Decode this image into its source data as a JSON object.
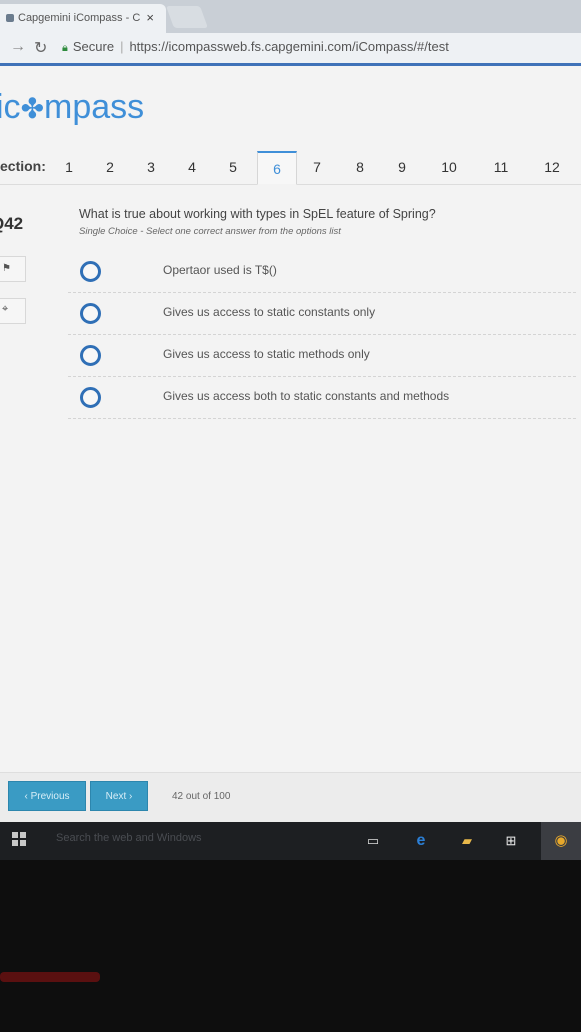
{
  "browser": {
    "tab_title": "Capgemini iCompass - C",
    "tab_close": "×",
    "secure_label": "Secure",
    "url": "https://icompassweb.fs.capgemini.com/iCompass/#/test"
  },
  "app": {
    "logo": "icompass",
    "section_label": "ection:",
    "sections": [
      "1",
      "2",
      "3",
      "4",
      "5",
      "6",
      "7",
      "8",
      "9",
      "10",
      "11",
      "12"
    ],
    "active_section": "6"
  },
  "question": {
    "number": "Q42",
    "text": "What is true about working with types in SpEL feature of Spring?",
    "hint": "Single Choice - Select one correct answer from the options list",
    "options": [
      "Opertaor used is T$()",
      "Gives us access to static constants only",
      "Gives us access to static methods only",
      "Gives us access both to static constants and methods"
    ]
  },
  "footer": {
    "previous_label": "‹ Previous",
    "next_label": "Next ›",
    "progress": "42 out of 100"
  },
  "taskbar": {
    "search_placeholder": "Search the web and Windows"
  },
  "colors": {
    "accent": "#3f8fd8",
    "radio": "#2f6fb6",
    "button": "#3a9bc4"
  }
}
